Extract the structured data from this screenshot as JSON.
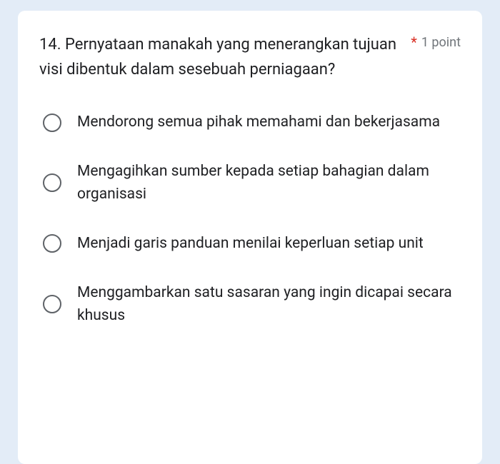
{
  "question": {
    "text": "14. Pernyataan manakah yang menerangkan tujuan visi dibentuk dalam sesebuah perniagaan?",
    "required_mark": "*",
    "points_label": "1 point"
  },
  "options": [
    {
      "label": "Mendorong semua pihak memahami dan bekerjasama"
    },
    {
      "label": "Mengagihkan sumber kepada setiap bahagian dalam organisasi"
    },
    {
      "label": "Menjadi garis panduan menilai keperluan setiap unit"
    },
    {
      "label": "Menggambarkan satu sasaran yang ingin dicapai secara khusus"
    }
  ]
}
